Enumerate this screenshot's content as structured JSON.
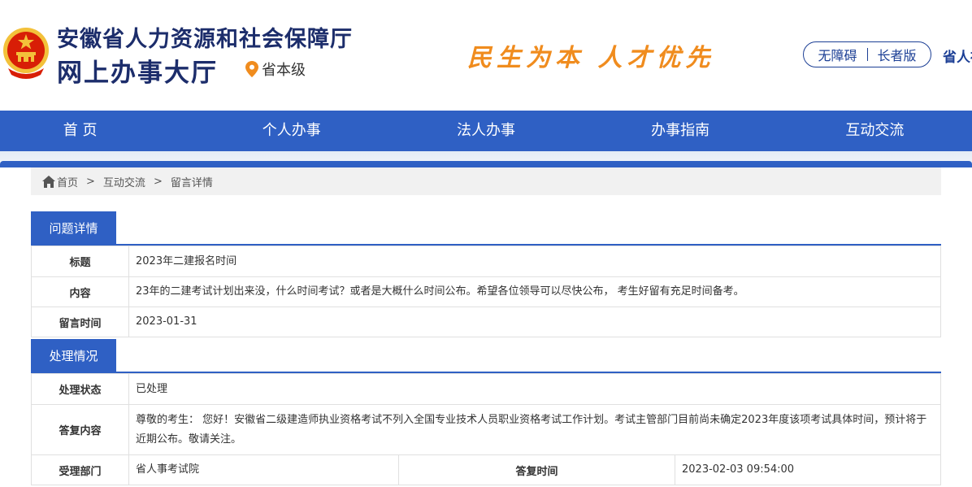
{
  "header": {
    "title": "安徽省人力资源和社会保障厅",
    "subtitle": "网上办事大厅",
    "location": "省本级",
    "slogan": "民生为本  人才优先",
    "accessibility_label": "无障碍",
    "elder_label": "长者版",
    "region_label": "省人社"
  },
  "nav": {
    "items": [
      "首 页",
      "个人办事",
      "法人办事",
      "办事指南",
      "互动交流"
    ]
  },
  "breadcrumb": {
    "home": "首页",
    "sep": ">",
    "level1": "互动交流",
    "level2": "留言详情"
  },
  "question": {
    "section_title": "问题详情",
    "rows": [
      {
        "label": "标题",
        "value": "2023年二建报名时间"
      },
      {
        "label": "内容",
        "value": "23年的二建考试计划出来没，什么时间考试？或者是大概什么时间公布。希望各位领导可以尽快公布， 考生好留有充足时间备考。"
      },
      {
        "label": "留言时间",
        "value": "2023-01-31"
      }
    ]
  },
  "handling": {
    "section_title": "处理情况",
    "status_label": "处理状态",
    "status_value": "已处理",
    "reply_label": "答复内容",
    "reply_value": "尊敬的考生： 您好！安徽省二级建造师执业资格考试不列入全国专业技术人员职业资格考试工作计划。考试主管部门目前尚未确定2023年度该项考试具体时间，预计将于近期公布。敬请关注。",
    "dept_label": "受理部门",
    "dept_value": "省人事考试院",
    "reply_time_label": "答复时间",
    "reply_time_value": "2023-02-03 09:54:00"
  },
  "colors": {
    "primary_blue": "#2f60c4",
    "title_navy": "#1c2d6b",
    "slogan_orange": "#f08c1e",
    "emblem_red": "#d81e06",
    "emblem_gold": "#f3c13a"
  }
}
